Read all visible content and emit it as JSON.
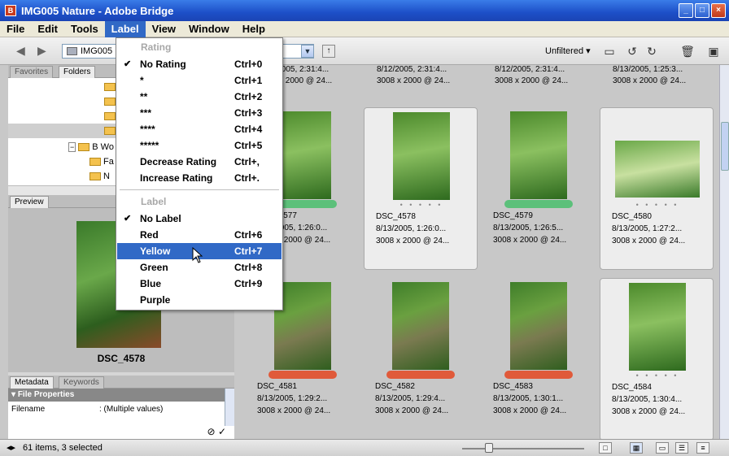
{
  "window": {
    "title": "IMG005 Nature - Adobe Bridge"
  },
  "menubar": [
    "File",
    "Edit",
    "Tools",
    "Label",
    "View",
    "Window",
    "Help"
  ],
  "toolbar": {
    "path": "IMG005",
    "filter": "Unfiltered"
  },
  "left_panel": {
    "top_tabs": [
      "Favorites",
      "Folders"
    ],
    "tree": [
      {
        "label": "B Wo"
      },
      {
        "label": "Fa"
      },
      {
        "label": "N"
      }
    ],
    "preview_tab": "Preview",
    "preview_caption": "DSC_4578",
    "meta_tabs": [
      "Metadata",
      "Keywords"
    ],
    "meta_section": "File Properties",
    "meta_rows": [
      {
        "key": "Filename",
        "value": ": (Multiple values)"
      }
    ]
  },
  "label_menu": {
    "rating_header": "Rating",
    "rating_items": [
      {
        "label": "No Rating",
        "shortcut": "Ctrl+0",
        "checked": true
      },
      {
        "label": "*",
        "shortcut": "Ctrl+1"
      },
      {
        "label": "**",
        "shortcut": "Ctrl+2"
      },
      {
        "label": "***",
        "shortcut": "Ctrl+3"
      },
      {
        "label": "****",
        "shortcut": "Ctrl+4"
      },
      {
        "label": "*****",
        "shortcut": "Ctrl+5"
      },
      {
        "label": "Decrease Rating",
        "shortcut": "Ctrl+,"
      },
      {
        "label": "Increase Rating",
        "shortcut": "Ctrl+."
      }
    ],
    "label_header": "Label",
    "label_items": [
      {
        "label": "No Label",
        "shortcut": "",
        "checked": true
      },
      {
        "label": "Red",
        "shortcut": "Ctrl+6"
      },
      {
        "label": "Yellow",
        "shortcut": "Ctrl+7",
        "highlighted": true
      },
      {
        "label": "Green",
        "shortcut": "Ctrl+8"
      },
      {
        "label": "Blue",
        "shortcut": "Ctrl+9"
      },
      {
        "label": "Purple",
        "shortcut": ""
      }
    ]
  },
  "thumbnails_top_row": [
    {
      "date": "8/12/2005, 2:31:4...",
      "dims": "3008 x 2000 @ 24..."
    },
    {
      "date": "8/12/2005, 2:31:4...",
      "dims": "3008 x 2000 @ 24..."
    },
    {
      "date": "8/12/2005, 2:31:4...",
      "dims": "3008 x 2000 @ 24..."
    },
    {
      "date": "8/13/2005, 1:25:3...",
      "dims": "3008 x 2000 @ 24..."
    }
  ],
  "thumbnails": [
    {
      "name": "DSC_4577",
      "date": "8/13/2005, 1:26:0...",
      "dims": "3008 x 2000 @ 24...",
      "label_color": "#5cc07a",
      "selected": false,
      "shape": "portrait"
    },
    {
      "name": "DSC_4578",
      "date": "8/13/2005, 1:26:0...",
      "dims": "3008 x 2000 @ 24...",
      "label_color": "",
      "selected": true,
      "shape": "portrait"
    },
    {
      "name": "DSC_4579",
      "date": "8/13/2005, 1:26:5...",
      "dims": "3008 x 2000 @ 24...",
      "label_color": "#5cc07a",
      "selected": false,
      "shape": "portrait"
    },
    {
      "name": "DSC_4580",
      "date": "8/13/2005, 1:27:2...",
      "dims": "3008 x 2000 @ 24...",
      "label_color": "",
      "selected": true,
      "shape": "landscape"
    },
    {
      "name": "DSC_4581",
      "date": "8/13/2005, 1:29:2...",
      "dims": "3008 x 2000 @ 24...",
      "label_color": "#e05a3a",
      "selected": false,
      "shape": "ivy"
    },
    {
      "name": "DSC_4582",
      "date": "8/13/2005, 1:29:4...",
      "dims": "3008 x 2000 @ 24...",
      "label_color": "#e05a3a",
      "selected": false,
      "shape": "ivy"
    },
    {
      "name": "DSC_4583",
      "date": "8/13/2005, 1:30:1...",
      "dims": "3008 x 2000 @ 24...",
      "label_color": "#e05a3a",
      "selected": false,
      "shape": "ivy"
    },
    {
      "name": "DSC_4584",
      "date": "8/13/2005, 1:30:4...",
      "dims": "3008 x 2000 @ 24...",
      "label_color": "",
      "selected": true,
      "shape": "portrait"
    }
  ],
  "status": {
    "text": "61 items, 3 selected"
  }
}
